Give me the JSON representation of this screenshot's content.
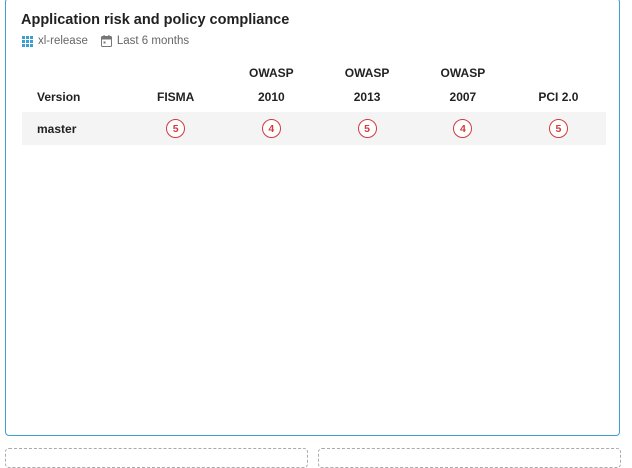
{
  "tile": {
    "title": "Application risk and policy compliance",
    "application": "xl-release",
    "time_range": "Last 6 months"
  },
  "table": {
    "version_header": "Version",
    "columns": [
      {
        "line1": "",
        "line2": "FISMA"
      },
      {
        "line1": "OWASP",
        "line2": "2010"
      },
      {
        "line1": "OWASP",
        "line2": "2013"
      },
      {
        "line1": "OWASP",
        "line2": "2007"
      },
      {
        "line1": "",
        "line2": "PCI 2.0"
      }
    ],
    "rows": [
      {
        "version": "master",
        "values": [
          "5",
          "4",
          "5",
          "4",
          "5"
        ]
      }
    ]
  },
  "colors": {
    "tile_border": "#3d9fd1",
    "badge_red": "#d13b3b",
    "row_bg": "#f4f4f4",
    "icon_blue": "#3d9fd1"
  },
  "icons": {
    "application": "grid-icon",
    "time_range": "calendar-icon"
  }
}
